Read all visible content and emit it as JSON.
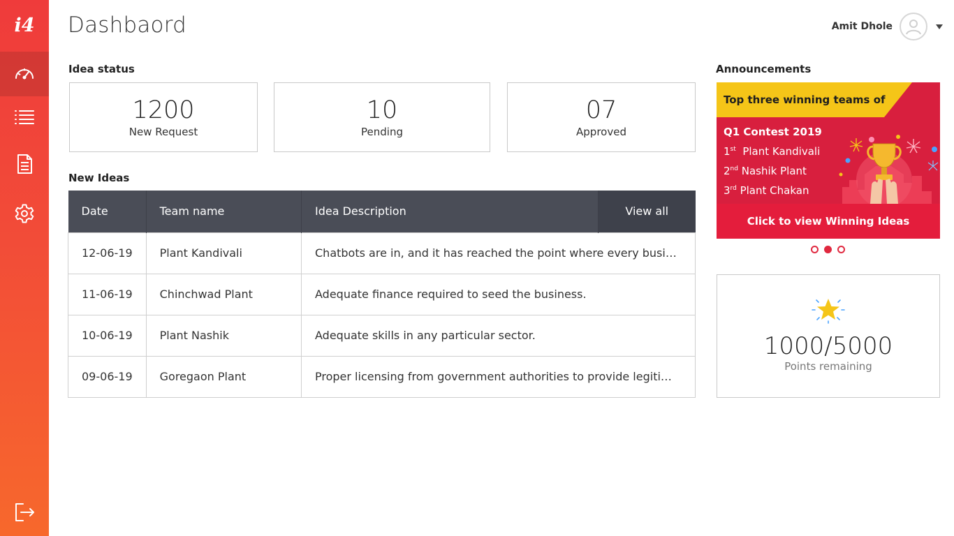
{
  "app": {
    "logo_text": "i4"
  },
  "sidebar": {
    "items": [
      {
        "name": "dashboard",
        "icon": "speedometer-icon",
        "active": true
      },
      {
        "name": "list",
        "icon": "list-icon",
        "active": false
      },
      {
        "name": "documents",
        "icon": "document-icon",
        "active": false
      },
      {
        "name": "settings",
        "icon": "gear-icon",
        "active": false
      },
      {
        "name": "logout",
        "icon": "logout-icon",
        "active": false
      }
    ]
  },
  "header": {
    "title": "Dashbaord",
    "user_name": "Amit Dhole"
  },
  "idea_status": {
    "label": "Idea status",
    "cards": [
      {
        "value": "1200",
        "label": "New Request"
      },
      {
        "value": "10",
        "label": "Pending"
      },
      {
        "value": "07",
        "label": "Approved"
      }
    ]
  },
  "new_ideas": {
    "label": "New Ideas",
    "columns": [
      "Date",
      "Team name",
      "Idea Description"
    ],
    "view_all": "View all",
    "rows": [
      {
        "date": "12-06-19",
        "team": "Plant Kandivali",
        "desc": "Chatbots are in, and it has reached the point where every business..."
      },
      {
        "date": "11-06-19",
        "team": "Chinchwad Plant",
        "desc": "Adequate finance required to seed the business."
      },
      {
        "date": "10-06-19",
        "team": "Plant Nashik",
        "desc": "Adequate skills in any particular sector."
      },
      {
        "date": "09-06-19",
        "team": "Goregaon Plant",
        "desc": "Proper licensing from government authorities to provide legitimacy..."
      }
    ]
  },
  "announcements": {
    "label": "Announcements",
    "banner": {
      "headline": "Top three winning teams of",
      "contest": "Q1 Contest 2019",
      "ranks": [
        {
          "rank": "1",
          "suffix": "st",
          "team": "Plant Kandivali"
        },
        {
          "rank": "2",
          "suffix": "nd",
          "team": "Nashik Plant"
        },
        {
          "rank": "3",
          "suffix": "rd",
          "team": "Plant Chakan"
        }
      ],
      "cta": "Click to view Winning Ideas"
    },
    "carousel_active_index": 1,
    "carousel_count": 3
  },
  "points": {
    "value": "1000/5000",
    "label": "Points remaining"
  },
  "colors": {
    "accent": "#e0283f",
    "sidebar_top": "#ef3b3b",
    "sidebar_bottom": "#f7682c",
    "table_header": "#4a4d57",
    "banner_yellow": "#f5c518"
  }
}
